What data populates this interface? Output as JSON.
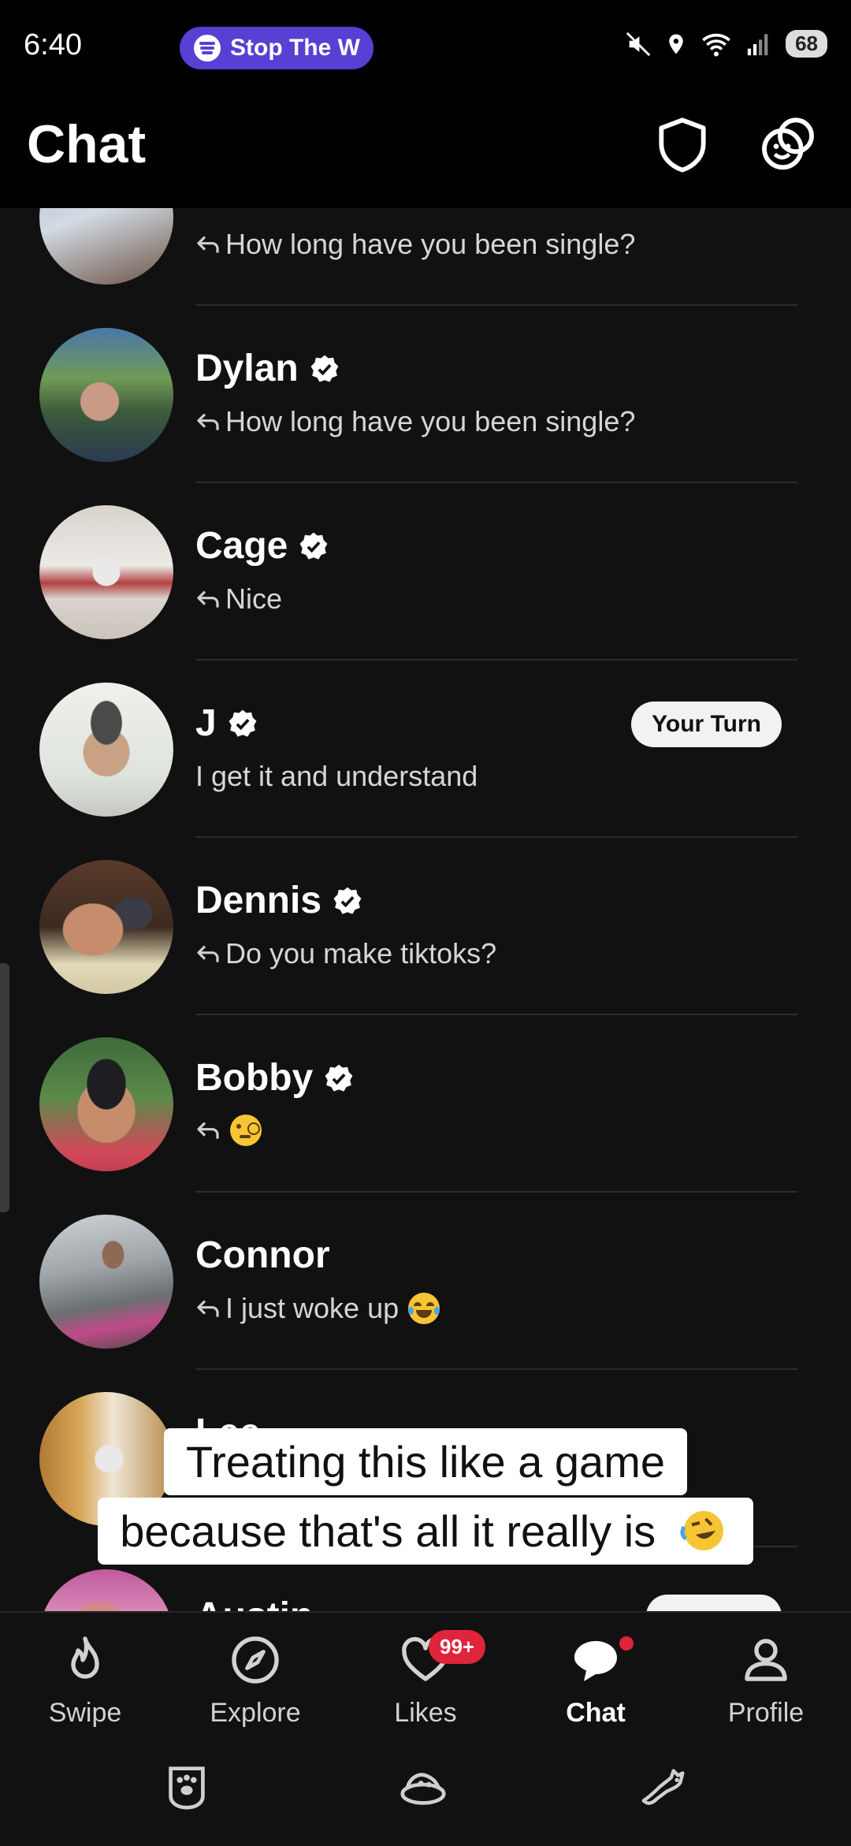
{
  "status_bar": {
    "time": "6:40",
    "media_pill": "Stop The W",
    "battery": "68"
  },
  "header": {
    "title": "Chat"
  },
  "conversations": [
    {
      "name": "",
      "preview": "How long have you been single?",
      "replied": true,
      "verified": false
    },
    {
      "name": "Dylan",
      "preview": "How long have you been single?",
      "replied": true,
      "verified": true
    },
    {
      "name": "Cage",
      "preview": "Nice",
      "replied": true,
      "verified": true
    },
    {
      "name": "J",
      "preview": "I get it and understand",
      "replied": false,
      "verified": true,
      "badge": "Your Turn"
    },
    {
      "name": "Dennis",
      "preview": "Do you make tiktoks?",
      "replied": true,
      "verified": true
    },
    {
      "name": "Bobby",
      "preview": "",
      "replied": true,
      "verified": true,
      "emoji": "monocle-face-emoji"
    },
    {
      "name": "Connor",
      "preview": "I just woke up",
      "replied": true,
      "verified": false,
      "emoji": "tears-of-joy-emoji"
    },
    {
      "name": "Lee",
      "preview": "",
      "replied": false,
      "verified": false
    },
    {
      "name": "Austin",
      "preview": "",
      "replied": false,
      "verified": false
    }
  ],
  "caption": {
    "line1": "Treating this like a game",
    "line2": "because that's all it really is",
    "emoji": "rolling-on-floor-laughing-emoji"
  },
  "bottom_nav": {
    "items": [
      {
        "label": "Swipe",
        "icon": "flame-icon"
      },
      {
        "label": "Explore",
        "icon": "compass-icon"
      },
      {
        "label": "Likes",
        "icon": "heart-icon",
        "badge": "99+"
      },
      {
        "label": "Chat",
        "icon": "chat-bubble-icon",
        "active": true
      },
      {
        "label": "Profile",
        "icon": "person-icon"
      }
    ]
  },
  "colors": {
    "background": "#121111",
    "accent_red": "#e0243b",
    "media_pill": "#5a3fd4"
  }
}
